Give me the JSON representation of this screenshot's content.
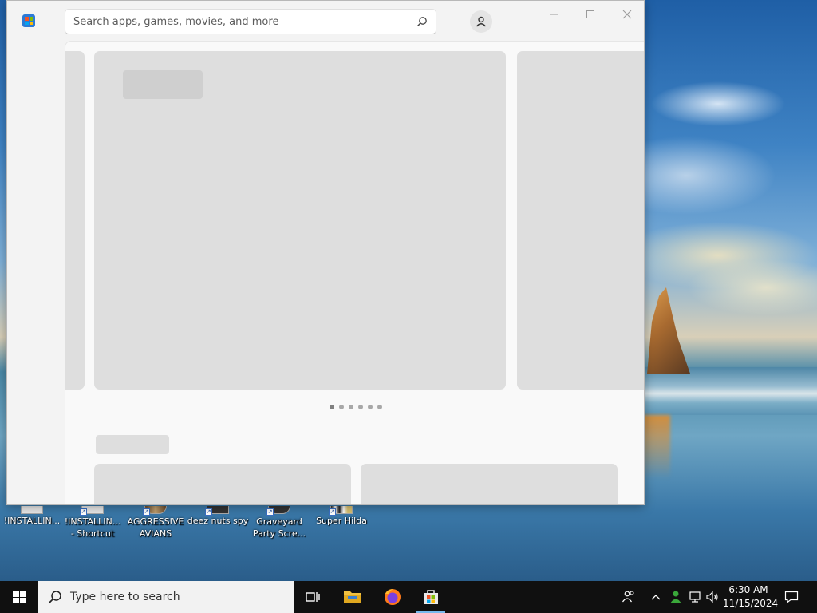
{
  "store": {
    "search_placeholder": "Search apps, games, movies, and more",
    "icons": {
      "logo": "microsoft-store-icon",
      "search": "search-icon",
      "account": "person-icon",
      "minimize": "minimize-icon",
      "maximize": "maximize-icon",
      "close": "close-icon"
    },
    "carousel_pages": 6,
    "carousel_active": 1
  },
  "desktop": {
    "icons": [
      {
        "label": "!INSTALLIN...",
        "shortcut": false
      },
      {
        "label": "!INSTALLIN... - Shortcut",
        "shortcut": true
      },
      {
        "label": "AGGRESSIVE AVIANS",
        "shortcut": true
      },
      {
        "label": "deez nuts spy",
        "shortcut": true
      },
      {
        "label": "Graveyard Party Scre...",
        "shortcut": true
      },
      {
        "label": "Super Hilda",
        "shortcut": true
      }
    ]
  },
  "taskbar": {
    "search_placeholder": "Type here to search",
    "apps": [
      "task-view-icon",
      "file-explorer-icon",
      "firefox-icon",
      "microsoft-store-icon"
    ],
    "active_app": "microsoft-store-icon",
    "clock_time": "6:30 AM",
    "clock_date": "11/15/2024",
    "accent_color": "#76b9ed"
  }
}
